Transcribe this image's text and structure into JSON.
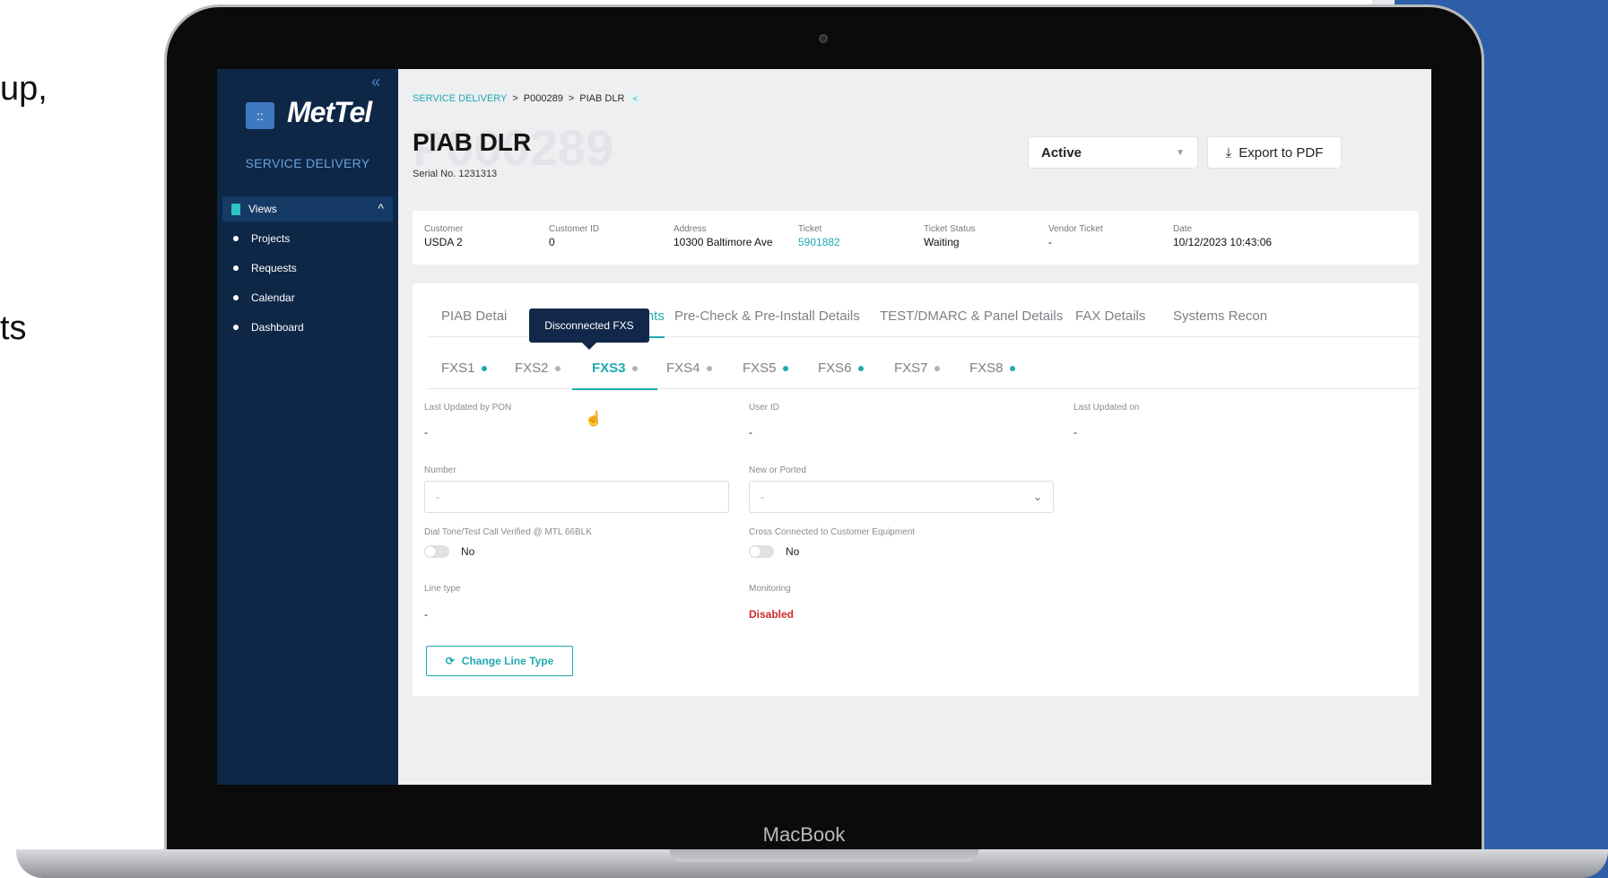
{
  "slide": {
    "text1": "up,",
    "text2": "ts"
  },
  "device_brand": "MacBook",
  "sidebar": {
    "collapse_icon": "«",
    "logo_icon": "::",
    "logo_text": "MetTel",
    "section_title": "SERVICE DELIVERY",
    "views_label": "Views",
    "views_chevron": "^",
    "items": [
      {
        "label": "Projects"
      },
      {
        "label": "Requests"
      },
      {
        "label": "Calendar"
      },
      {
        "label": "Dashboard"
      }
    ]
  },
  "breadcrumb": {
    "root": "SERVICE DELIVERY",
    "sep": ">",
    "project": "P000289",
    "current": "PIAB DLR",
    "share_icon": "<"
  },
  "page": {
    "ghost_title": "P000289",
    "title": "PIAB DLR",
    "serial": "Serial No. 1231313"
  },
  "status_select": {
    "value": "Active",
    "caret": "▼"
  },
  "export": {
    "icon": "⤓",
    "label": "Export to PDF"
  },
  "info": {
    "customer_label": "Customer",
    "customer_value": "USDA 2",
    "customer_id_label": "Customer ID",
    "customer_id_value": "0",
    "address_label": "Address",
    "address_value": "10300 Baltimore Ave",
    "ticket_label": "Ticket",
    "ticket_value": "5901882",
    "ticket_status_label": "Ticket Status",
    "ticket_status_value": "Waiting",
    "vendor_ticket_label": "Vendor  Ticket",
    "vendor_ticket_value": "-",
    "date_label": "Date",
    "date_value": "10/12/2023 10:43:06"
  },
  "tabs": [
    {
      "label": "PIAB Detai"
    },
    {
      "label": "ments"
    },
    {
      "label": "Pre-Check & Pre-Install Details"
    },
    {
      "label": "TEST/DMARC & Panel Details"
    },
    {
      "label": "FAX Details"
    },
    {
      "label": "Systems Recon"
    }
  ],
  "tooltip": "Disconnected FXS",
  "subtabs": [
    {
      "label": "FXS1",
      "dot": "#1fa9b0"
    },
    {
      "label": "FXS2",
      "dot": "#b0b2b6"
    },
    {
      "label": "FXS3",
      "dot": "#b0b2b6"
    },
    {
      "label": "FXS4",
      "dot": "#b0b2b6"
    },
    {
      "label": "FXS5",
      "dot": "#1fa9b0"
    },
    {
      "label": "FXS6",
      "dot": "#1fa9b0"
    },
    {
      "label": "FXS7",
      "dot": "#b0b2b6"
    },
    {
      "label": "FXS8",
      "dot": "#1fa9b0"
    }
  ],
  "fields": {
    "last_updated_by_label": "Last Updated by PON",
    "last_updated_by_value": "-",
    "user_id_label": "User ID",
    "user_id_value": "-",
    "last_updated_on_label": "Last Updated on",
    "last_updated_on_value": "-",
    "number_label": "Number",
    "number_placeholder": "-",
    "new_or_ported_label": "New or Ported",
    "new_or_ported_value": "-",
    "dial_tone_label": "Dial Tone/Test Call Verified @ MTL 66BLK",
    "dial_tone_value": "No",
    "cross_connected_label": "Cross Connected to Customer Equipment",
    "cross_connected_value": "No",
    "line_type_label": "Line type",
    "line_type_value": "-",
    "monitoring_label": "Monitoring",
    "monitoring_value": "Disabled"
  },
  "change_line_type": {
    "icon": "⟳",
    "label": "Change Line Type"
  },
  "colors": {
    "accent": "#1fa9b0",
    "sidebar": "#0e2747",
    "danger": "#cf2a2a",
    "slide_blue": "#2f5ea8"
  }
}
